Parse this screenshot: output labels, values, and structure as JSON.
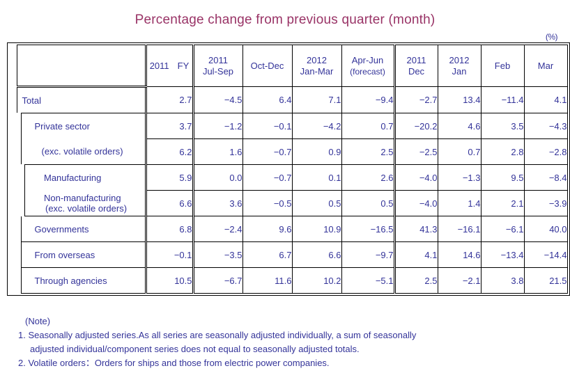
{
  "title": "Percentage change from previous quarter (month)",
  "unit": "(%)",
  "colors": {
    "title": "#993366",
    "label_text": "#333399",
    "value_text": "#007700",
    "border": "#000000"
  },
  "table": {
    "columns": [
      {
        "key": "row_label",
        "year": "",
        "period": "",
        "sub": ""
      },
      {
        "key": "fy2011",
        "year": "2011",
        "period": "FY",
        "sub": "",
        "style": "fy"
      },
      {
        "key": "jul_sep",
        "year": "2011",
        "period": "Jul-Sep",
        "sub": ""
      },
      {
        "key": "oct_dec",
        "year": "",
        "period": "Oct-Dec",
        "sub": ""
      },
      {
        "key": "jan_mar",
        "year": "2012",
        "period": "Jan-Mar",
        "sub": ""
      },
      {
        "key": "apr_jun",
        "year": "",
        "period": "Apr-Jun",
        "sub": "(forecast)"
      },
      {
        "key": "dec",
        "year": "2011",
        "period": "Dec",
        "sub": ""
      },
      {
        "key": "jan",
        "year": "2012",
        "period": "Jan",
        "sub": ""
      },
      {
        "key": "feb",
        "year": "",
        "period": "Feb",
        "sub": ""
      },
      {
        "key": "mar",
        "year": "",
        "period": "Mar",
        "sub": ""
      }
    ],
    "rows": [
      {
        "label": "Total",
        "label2": "",
        "indent": 0,
        "values": [
          "2.7",
          "−4.5",
          "6.4",
          "7.1",
          "−9.4",
          "−2.7",
          "13.4",
          "−11.4",
          "4.1"
        ]
      },
      {
        "label": "Private sector",
        "label2": "",
        "indent": 1,
        "values": [
          "3.7",
          "−1.2",
          "−0.1",
          "−4.2",
          "0.7",
          "−20.2",
          "4.6",
          "3.5",
          "−4.3"
        ]
      },
      {
        "label": "(exc. volatile orders)",
        "label2": "",
        "indent": 1,
        "values": [
          "6.2",
          "1.6",
          "−0.7",
          "0.9",
          "2.5",
          "−2.5",
          "0.7",
          "2.8",
          "−2.8"
        ]
      },
      {
        "label": "Manufacturing",
        "label2": "",
        "indent": 2,
        "values": [
          "5.9",
          "0.0",
          "−0.7",
          "0.1",
          "2.6",
          "−4.0",
          "−1.3",
          "9.5",
          "−8.4"
        ]
      },
      {
        "label": "Non-manufacturing",
        "label2": "(exc. volatile orders)",
        "indent": 2,
        "values": [
          "6.6",
          "3.6",
          "−0.5",
          "0.5",
          "0.5",
          "−4.0",
          "1.4",
          "2.1",
          "−3.9"
        ]
      },
      {
        "label": "Governments",
        "label2": "",
        "indent": 1,
        "values": [
          "6.8",
          "−2.4",
          "9.6",
          "10.9",
          "−16.5",
          "41.3",
          "−16.1",
          "−6.1",
          "40.0"
        ]
      },
      {
        "label": "From overseas",
        "label2": "",
        "indent": 1,
        "values": [
          "−0.1",
          "−3.5",
          "6.7",
          "6.6",
          "−9.7",
          "4.1",
          "14.6",
          "−13.4",
          "−14.4"
        ]
      },
      {
        "label": "Through agencies",
        "label2": "",
        "indent": 1,
        "values": [
          "10.5",
          "−6.7",
          "11.6",
          "10.2",
          "−5.1",
          "2.5",
          "−2.1",
          "3.8",
          "21.5"
        ]
      }
    ]
  },
  "notes": {
    "heading": "(Note)",
    "items": [
      "1. Seasonally adjusted series.As all series are seasonally adjusted individually,  a sum of seasonally",
      "adjusted individual/component series does not equal to seasonally adjusted totals.",
      "2. Volatile orders：Orders for ships and those from electric power companies."
    ]
  },
  "chart_data": {
    "type": "table",
    "title": "Percentage change from previous quarter (month)",
    "unit": "%",
    "categories": [
      "2011 FY",
      "2011 Jul-Sep",
      "Oct-Dec",
      "2012 Jan-Mar",
      "Apr-Jun (forecast)",
      "2011 Dec",
      "2012 Jan",
      "Feb",
      "Mar"
    ],
    "series": [
      {
        "name": "Total",
        "values": [
          2.7,
          -4.5,
          6.4,
          7.1,
          -9.4,
          -2.7,
          13.4,
          -11.4,
          4.1
        ]
      },
      {
        "name": "Private sector",
        "values": [
          3.7,
          -1.2,
          -0.1,
          -4.2,
          0.7,
          -20.2,
          4.6,
          3.5,
          -4.3
        ]
      },
      {
        "name": "Private sector (exc. volatile orders)",
        "values": [
          6.2,
          1.6,
          -0.7,
          0.9,
          2.5,
          -2.5,
          0.7,
          2.8,
          -2.8
        ]
      },
      {
        "name": "Manufacturing",
        "values": [
          5.9,
          0.0,
          -0.7,
          0.1,
          2.6,
          -4.0,
          -1.3,
          9.5,
          -8.4
        ]
      },
      {
        "name": "Non-manufacturing (exc. volatile orders)",
        "values": [
          6.6,
          3.6,
          -0.5,
          0.5,
          0.5,
          -4.0,
          1.4,
          2.1,
          -3.9
        ]
      },
      {
        "name": "Governments",
        "values": [
          6.8,
          -2.4,
          9.6,
          10.9,
          -16.5,
          41.3,
          -16.1,
          -6.1,
          40.0
        ]
      },
      {
        "name": "From overseas",
        "values": [
          -0.1,
          -3.5,
          6.7,
          6.6,
          -9.7,
          4.1,
          14.6,
          -13.4,
          -14.4
        ]
      },
      {
        "name": "Through agencies",
        "values": [
          10.5,
          -6.7,
          11.6,
          10.2,
          -5.1,
          2.5,
          -2.1,
          3.8,
          21.5
        ]
      }
    ]
  }
}
